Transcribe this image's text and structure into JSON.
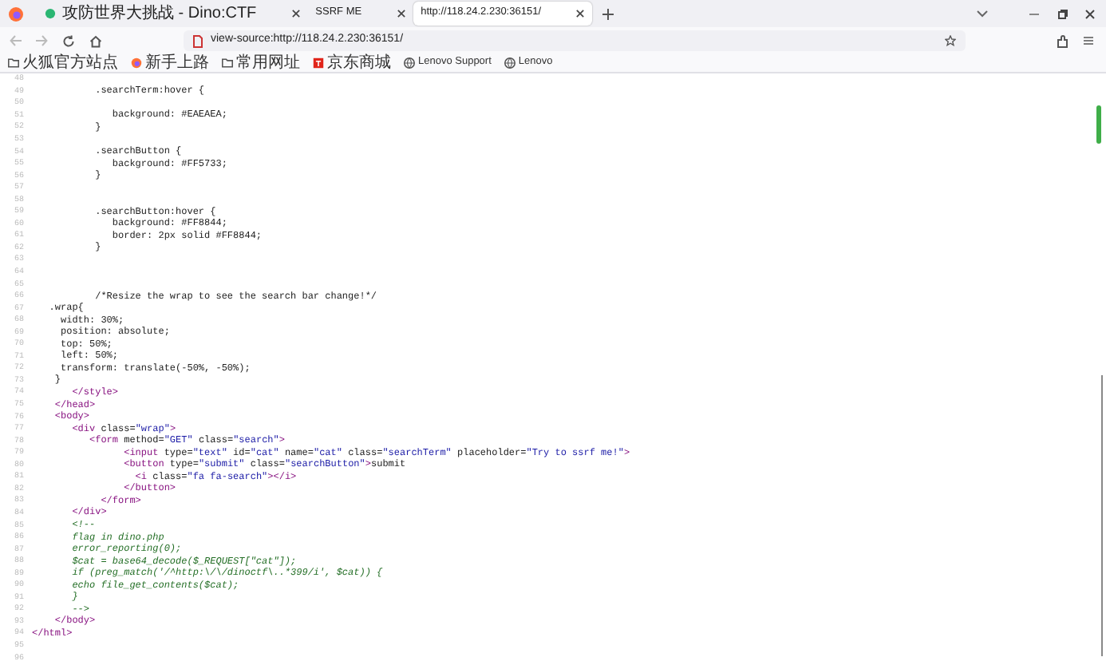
{
  "tabs": [
    {
      "title": "攻防世界大挑战 - Dino:CTF",
      "favicon": true,
      "selected": false
    },
    {
      "title": "SSRF ME",
      "favicon": false,
      "selected": false
    },
    {
      "title": "http://118.24.2.230:36151/",
      "favicon": false,
      "selected": true
    }
  ],
  "address_bar": {
    "url": "view-source:http://118.24.2.230:36151/"
  },
  "bookmarks": [
    {
      "label": "火狐官方站点",
      "kind": "folder"
    },
    {
      "label": "新手上路",
      "kind": "firefox"
    },
    {
      "label": "常用网址",
      "kind": "folder"
    },
    {
      "label": "京东商城",
      "kind": "shop"
    },
    {
      "label": "Lenovo Support",
      "kind": "globe"
    },
    {
      "label": "Lenovo",
      "kind": "globe"
    }
  ],
  "source_lines": [
    {
      "number": "48"
    },
    {
      "number": "49",
      "tokens": [
        {
          "kind": "text",
          "text": "           .searchTerm:hover {"
        }
      ]
    },
    {
      "number": "50"
    },
    {
      "number": "51",
      "tokens": [
        {
          "kind": "text",
          "text": "              background: #EAEAEA;"
        }
      ]
    },
    {
      "number": "52",
      "tokens": [
        {
          "kind": "text",
          "text": "           }"
        }
      ]
    },
    {
      "number": "53"
    },
    {
      "number": "54",
      "tokens": [
        {
          "kind": "text",
          "text": "           .searchButton {"
        }
      ]
    },
    {
      "number": "55",
      "tokens": [
        {
          "kind": "text",
          "text": "              background: #FF5733;"
        }
      ]
    },
    {
      "number": "56",
      "tokens": [
        {
          "kind": "text",
          "text": "           }"
        }
      ]
    },
    {
      "number": "57"
    },
    {
      "number": "58"
    },
    {
      "number": "59",
      "tokens": [
        {
          "kind": "text",
          "text": "           .searchButton:hover {"
        }
      ]
    },
    {
      "number": "60",
      "tokens": [
        {
          "kind": "text",
          "text": "              background: #FF8844;"
        }
      ]
    },
    {
      "number": "61",
      "tokens": [
        {
          "kind": "text",
          "text": "              border: 2px solid #FF8844;"
        }
      ]
    },
    {
      "number": "62",
      "tokens": [
        {
          "kind": "text",
          "text": "           }"
        }
      ]
    },
    {
      "number": "63"
    },
    {
      "number": "64"
    },
    {
      "number": "65"
    },
    {
      "number": "66",
      "tokens": [
        {
          "kind": "text",
          "text": "           /*Resize the wrap to see the search bar change!*/"
        }
      ]
    },
    {
      "number": "67",
      "tokens": [
        {
          "kind": "text",
          "text": "   .wrap{"
        }
      ]
    },
    {
      "number": "68",
      "tokens": [
        {
          "kind": "text",
          "text": "     width: 30%;"
        }
      ]
    },
    {
      "number": "69",
      "tokens": [
        {
          "kind": "text",
          "text": "     position: absolute;"
        }
      ]
    },
    {
      "number": "70",
      "tokens": [
        {
          "kind": "text",
          "text": "     top: 50%;"
        }
      ]
    },
    {
      "number": "71",
      "tokens": [
        {
          "kind": "text",
          "text": "     left: 50%;"
        }
      ]
    },
    {
      "number": "72",
      "tokens": [
        {
          "kind": "text",
          "text": "     transform: translate(-50%, -50%);"
        }
      ]
    },
    {
      "number": "73",
      "tokens": [
        {
          "kind": "text",
          "text": "    }"
        }
      ]
    },
    {
      "number": "74",
      "tokens": [
        {
          "kind": "tag",
          "text": "       </style>"
        }
      ]
    },
    {
      "number": "75",
      "tokens": [
        {
          "kind": "tag",
          "text": "    </head>"
        }
      ]
    },
    {
      "number": "76",
      "tokens": [
        {
          "kind": "tag",
          "text": "    <body>"
        }
      ]
    },
    {
      "number": "77",
      "tokens": [
        {
          "kind": "tag",
          "text": "       <div"
        },
        {
          "kind": "attr",
          "text": " class="
        },
        {
          "kind": "value",
          "text": "\"wrap\""
        },
        {
          "kind": "tag",
          "text": ">"
        }
      ]
    },
    {
      "number": "78",
      "tokens": [
        {
          "kind": "tag",
          "text": "          <form"
        },
        {
          "kind": "attr",
          "text": " method="
        },
        {
          "kind": "value",
          "text": "\"GET\""
        },
        {
          "kind": "attr",
          "text": " class="
        },
        {
          "kind": "value",
          "text": "\"search\""
        },
        {
          "kind": "tag",
          "text": ">"
        }
      ]
    },
    {
      "number": "79",
      "tokens": [
        {
          "kind": "tag",
          "text": "                <input"
        },
        {
          "kind": "attr",
          "text": " type="
        },
        {
          "kind": "value",
          "text": "\"text\""
        },
        {
          "kind": "attr",
          "text": " id="
        },
        {
          "kind": "value",
          "text": "\"cat\""
        },
        {
          "kind": "attr",
          "text": " name="
        },
        {
          "kind": "value",
          "text": "\"cat\""
        },
        {
          "kind": "attr",
          "text": " class="
        },
        {
          "kind": "value",
          "text": "\"searchTerm\""
        },
        {
          "kind": "attr",
          "text": " placeholder="
        },
        {
          "kind": "value",
          "text": "\"Try to ssrf me!\""
        },
        {
          "kind": "tag",
          "text": ">"
        }
      ]
    },
    {
      "number": "80",
      "tokens": [
        {
          "kind": "tag",
          "text": "                <button"
        },
        {
          "kind": "attr",
          "text": " type="
        },
        {
          "kind": "value",
          "text": "\"submit\""
        },
        {
          "kind": "attr",
          "text": " class="
        },
        {
          "kind": "value",
          "text": "\"searchButton\""
        },
        {
          "kind": "tag",
          "text": ">"
        },
        {
          "kind": "text",
          "text": "submit"
        }
      ]
    },
    {
      "number": "81",
      "tokens": [
        {
          "kind": "tag",
          "text": "                  <i"
        },
        {
          "kind": "attr",
          "text": " class="
        },
        {
          "kind": "value",
          "text": "\"fa fa-search\""
        },
        {
          "kind": "tag",
          "text": "></i>"
        }
      ]
    },
    {
      "number": "82",
      "tokens": [
        {
          "kind": "tag",
          "text": "                </button>"
        }
      ]
    },
    {
      "number": "83",
      "tokens": [
        {
          "kind": "tag",
          "text": "            </form>"
        }
      ]
    },
    {
      "number": "84",
      "tokens": [
        {
          "kind": "tag",
          "text": "       </div>"
        }
      ]
    },
    {
      "number": "85",
      "tokens": [
        {
          "kind": "comment",
          "text": "       <!--"
        }
      ]
    },
    {
      "number": "86",
      "tokens": [
        {
          "kind": "comment",
          "text": "       flag in dino.php"
        }
      ]
    },
    {
      "number": "87",
      "tokens": [
        {
          "kind": "comment",
          "text": "       error_reporting(0);"
        }
      ]
    },
    {
      "number": "88",
      "tokens": [
        {
          "kind": "comment",
          "text": "       $cat = base64_decode($_REQUEST[\"cat\"]);"
        }
      ]
    },
    {
      "number": "89",
      "tokens": [
        {
          "kind": "comment",
          "text": "       if (preg_match('/^http:\\/\\/dinoctf\\..*399/i', $cat)) {"
        }
      ]
    },
    {
      "number": "90",
      "tokens": [
        {
          "kind": "comment",
          "text": "       echo file_get_contents($cat);"
        }
      ]
    },
    {
      "number": "91",
      "tokens": [
        {
          "kind": "comment",
          "text": "       }"
        }
      ]
    },
    {
      "number": "92",
      "tokens": [
        {
          "kind": "comment",
          "text": "       -->"
        }
      ]
    },
    {
      "number": "93",
      "tokens": [
        {
          "kind": "tag",
          "text": "    </body>"
        }
      ]
    },
    {
      "number": "94",
      "tokens": [
        {
          "kind": "tag",
          "text": "</html>"
        }
      ]
    },
    {
      "number": "95"
    },
    {
      "number": "96"
    }
  ]
}
